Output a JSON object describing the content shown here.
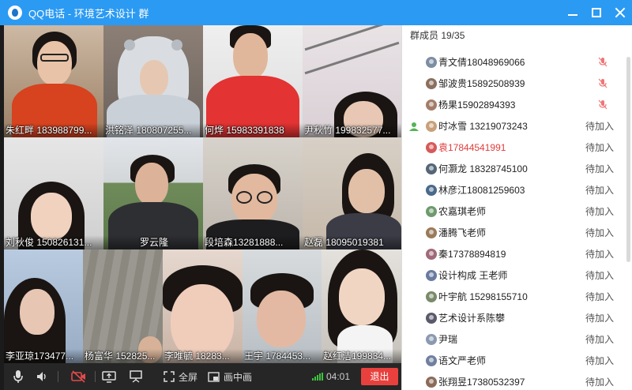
{
  "window": {
    "title": "QQ电话 - 环境艺术设计 群"
  },
  "participants": [
    "朱红畔 183988799...",
    "洪铭泽 180807255...",
    "何烨 15983391838",
    "尹秋竹 199832577...",
    "刘秋俊 150826131...",
    "罗云隆",
    "段培森13281888...",
    "赵磊 18095019381",
    "李亚琼173477...",
    "杨富华 152825...",
    "李唯毓 18283...",
    "王宇 1784453...",
    "赵红洁199834..."
  ],
  "toolbar": {
    "fullscreen_label": "全屏",
    "pip_label": "画中画",
    "time": "04:01",
    "exit_label": "退出"
  },
  "panel": {
    "header": "群成员 19/35",
    "members": [
      {
        "name": "青文倩18048969066",
        "status": "",
        "muted": true
      },
      {
        "name": "邹波贵15892508939",
        "status": "",
        "muted": true
      },
      {
        "name": "杨果15902894393",
        "status": "",
        "muted": true
      },
      {
        "name": "时冰雪 13219073243",
        "status": "待加入",
        "muted": false
      },
      {
        "name": "袁17844541991",
        "status": "待加入",
        "muted": false
      },
      {
        "name": "何灏龙 18328745100",
        "status": "待加入",
        "muted": false
      },
      {
        "name": "林彦江18081259603",
        "status": "待加入",
        "muted": false
      },
      {
        "name": "农嘉琪老师",
        "status": "待加入",
        "muted": false
      },
      {
        "name": "潘腾飞老师",
        "status": "待加入",
        "muted": false
      },
      {
        "name": "秦17378894819",
        "status": "待加入",
        "muted": false
      },
      {
        "name": "设计构成 王老师",
        "status": "待加入",
        "muted": false
      },
      {
        "name": "叶宇航 15298155710",
        "status": "待加入",
        "muted": false
      },
      {
        "name": "艺术设计系陈攀",
        "status": "待加入",
        "muted": false
      },
      {
        "name": "尹瑞",
        "status": "待加入",
        "muted": false
      },
      {
        "name": "语文严老师",
        "status": "待加入",
        "muted": false
      },
      {
        "name": "张翔昱17380532397",
        "status": "待加入",
        "muted": false
      }
    ]
  },
  "colors": {
    "titlebar": "#2b9af3",
    "exit_button": "#e8413d",
    "highlight_member": "#e23b3b",
    "signal": "#3ec43e"
  }
}
